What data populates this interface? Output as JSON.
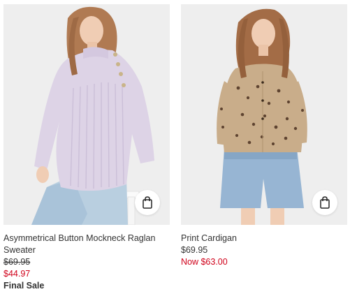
{
  "products": [
    {
      "name": "Asymmetrical Button Mockneck Raglan Sweater",
      "original_price": "$69.95",
      "sale_price": "$44.97",
      "badge": "Final Sale",
      "image_alt": "Woman in lavender ribbed sweater with buttons",
      "bag_icon": "shopping-bag-icon"
    },
    {
      "name": "Print Cardigan",
      "original_price": "$69.95",
      "sale_price": "Now $63.00",
      "image_alt": "Woman in leopard print cardigan and denim shorts",
      "bag_icon": "shopping-bag-icon"
    }
  ],
  "colors": {
    "sale_red": "#d0021b",
    "text": "#333333",
    "image_bg": "#ececec"
  }
}
